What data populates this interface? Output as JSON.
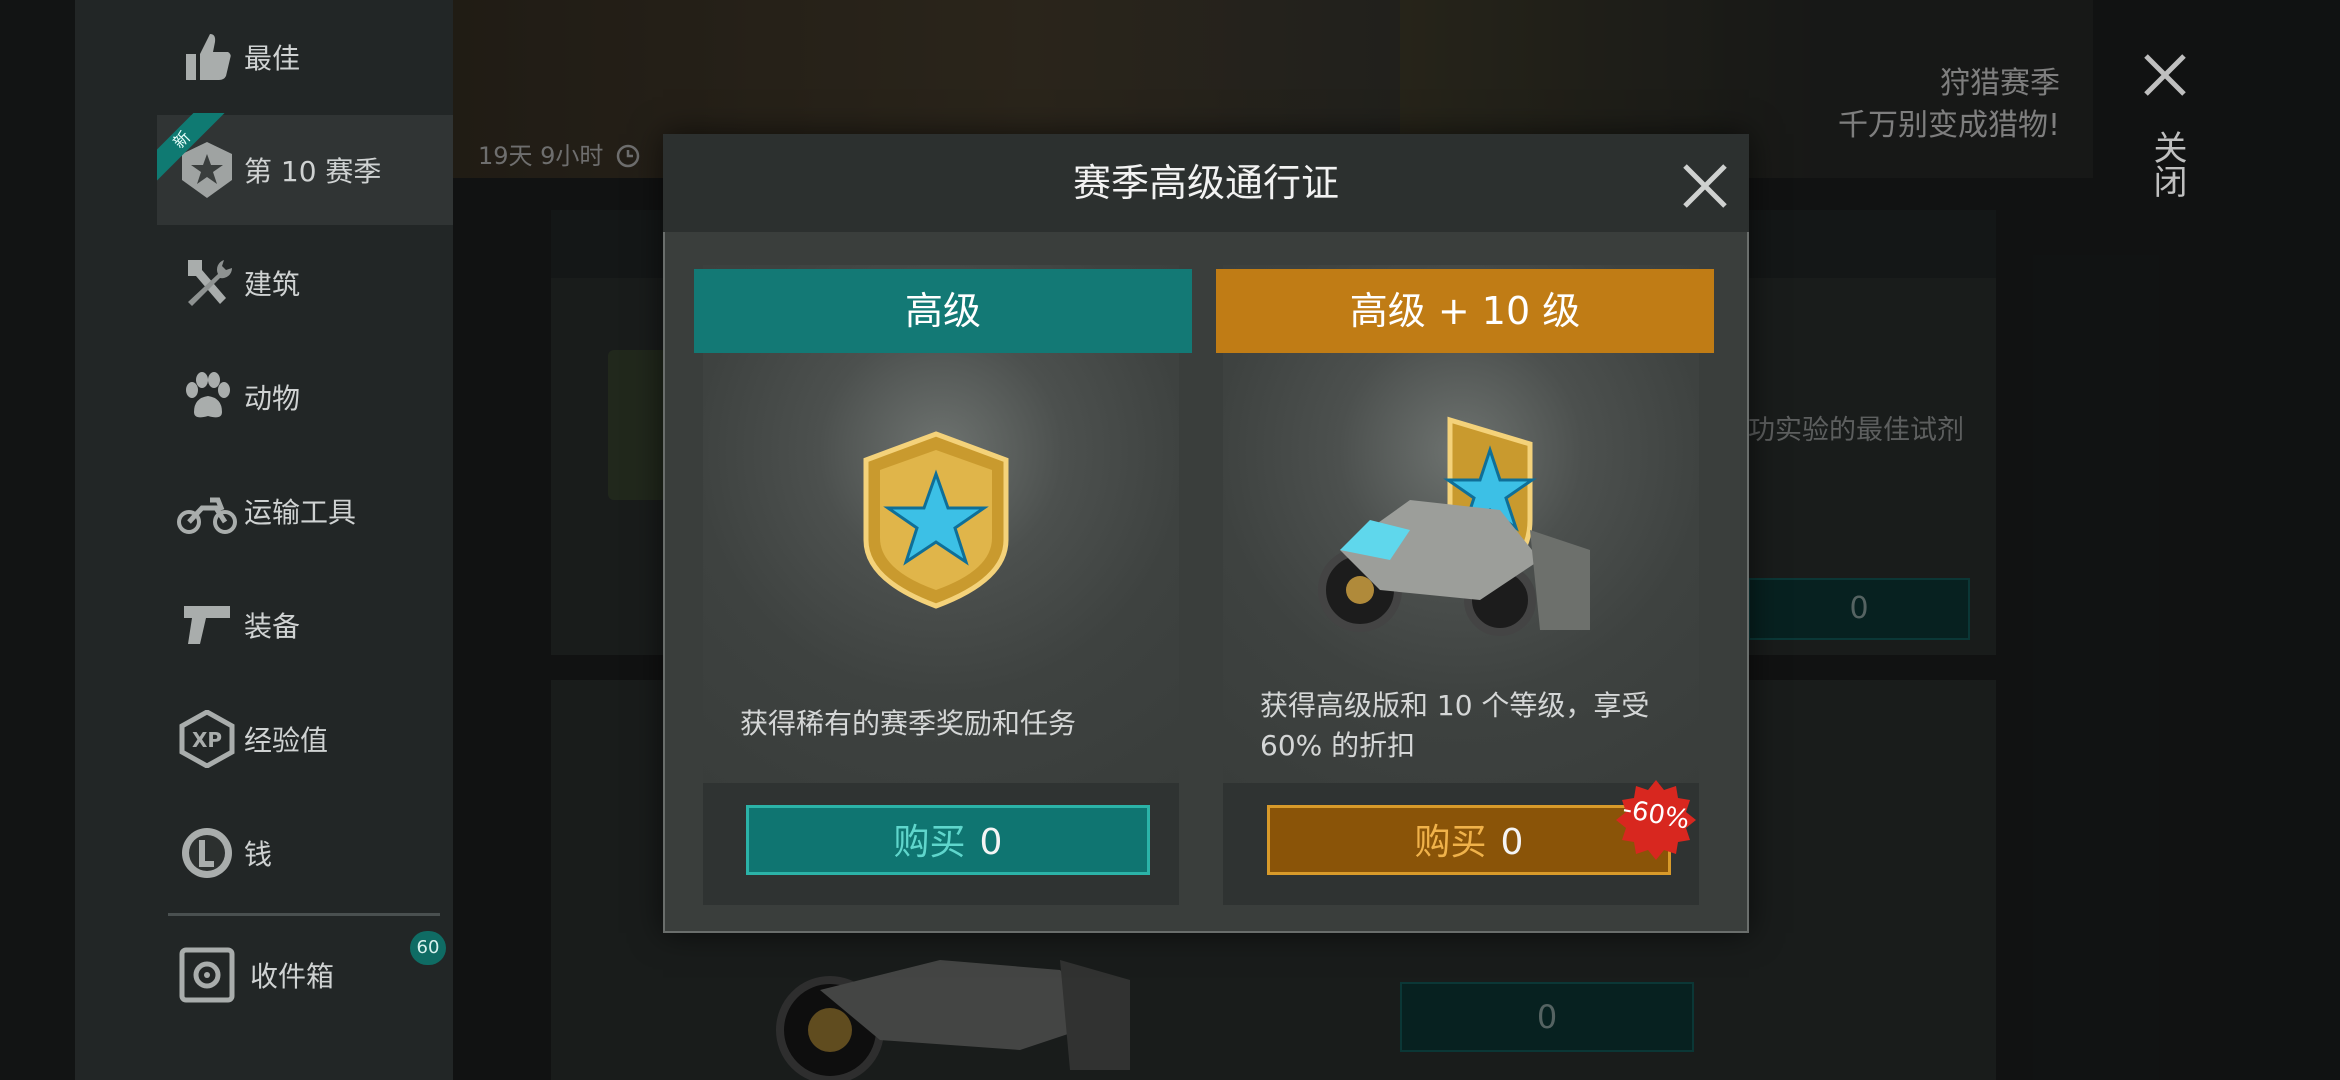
{
  "sidebar": {
    "items": [
      {
        "label": "最佳",
        "icon": "thumbs-up-icon"
      },
      {
        "label": "第 10 赛季",
        "icon": "season-badge-icon",
        "ribbon": "新"
      },
      {
        "label": "建筑",
        "icon": "hammer-wrench-icon"
      },
      {
        "label": "动物",
        "icon": "paw-icon"
      },
      {
        "label": "运输工具",
        "icon": "motorcycle-icon"
      },
      {
        "label": "装备",
        "icon": "pistol-icon"
      },
      {
        "label": "经验值",
        "icon": "xp-icon"
      },
      {
        "label": "钱",
        "icon": "coin-icon"
      }
    ],
    "storage": {
      "label": "收件箱",
      "icon": "safe-icon",
      "badge": "60"
    }
  },
  "banner": {
    "timer": "19天 9小时",
    "title": "狩猎赛季",
    "subtitle": "千万别变成猎物!",
    "close_label": "关闭"
  },
  "background": {
    "desc_fragment": "功实验的最佳试剂",
    "price1": "0",
    "price2": "0"
  },
  "modal": {
    "title": "赛季高级通行证",
    "cards": [
      {
        "header": "高级",
        "description": "获得稀有的赛季奖励和任务",
        "buy_label": "购买",
        "price": "0",
        "color": "#137975"
      },
      {
        "header": "高级 + 10 级",
        "description": "获得高级版和 10 个等级，享受 60% 的折扣",
        "buy_label": "购买",
        "price": "0",
        "discount": "-60%",
        "color": "#c07c15"
      }
    ]
  }
}
